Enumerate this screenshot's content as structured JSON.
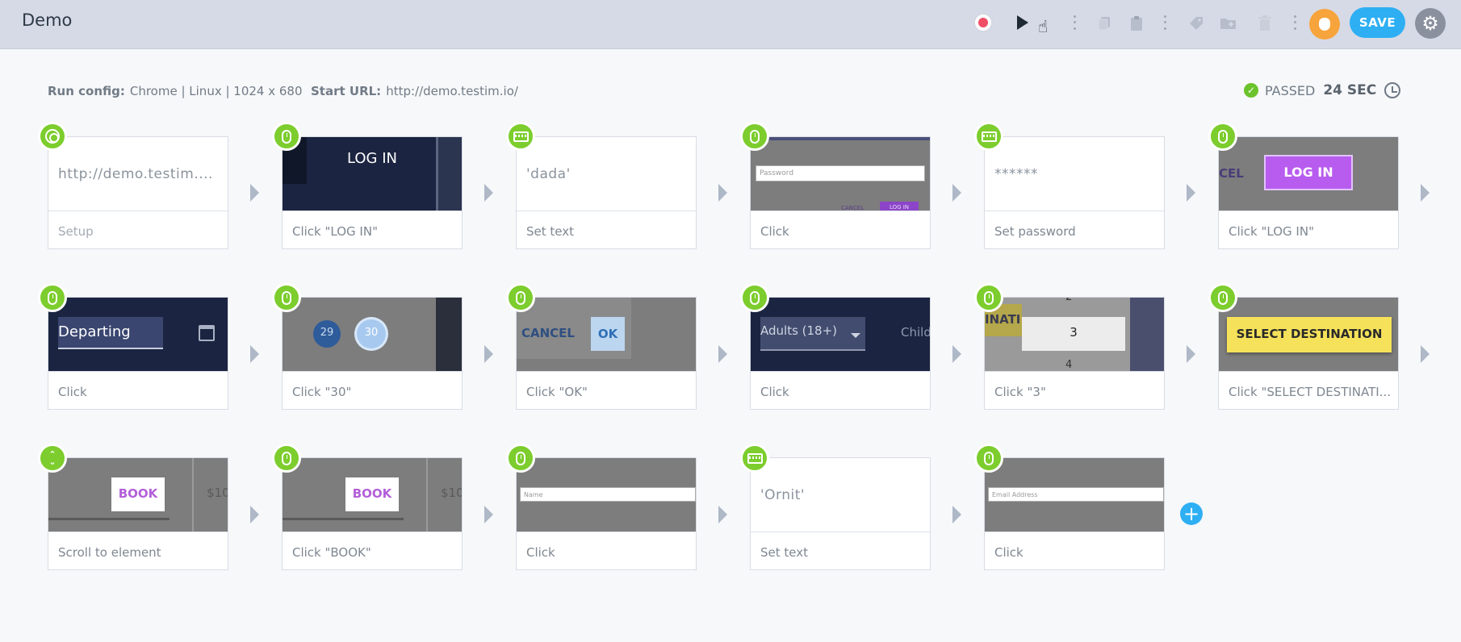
{
  "app": {
    "title": "Demo"
  },
  "toolbar": {
    "save_label": "SAVE"
  },
  "run_config": {
    "label": "Run config:",
    "value": "Chrome | Linux | 1024 x 680"
  },
  "start_url": {
    "label": "Start URL:",
    "value": "http://demo.testim.io/"
  },
  "result": {
    "status": "PASSED",
    "duration": "24 SEC"
  },
  "steps": [
    {
      "label": "Setup",
      "preview_text": "http://demo.testim....",
      "badge": "chrome-icon"
    },
    {
      "label": "Click \"LOG IN\"",
      "preview_text": "LOG IN",
      "badge": "mouse-icon"
    },
    {
      "label": "Set text",
      "preview_text": "'dada'",
      "badge": "keyboard-icon"
    },
    {
      "label": "Click",
      "preview_text": "Password",
      "preview_extra": [
        "CANCEL",
        "LOG IN"
      ],
      "badge": "mouse-icon"
    },
    {
      "label": "Set password",
      "preview_text": "******",
      "badge": "keyboard-icon"
    },
    {
      "label": "Click \"LOG IN\"",
      "preview_text": "LOG IN",
      "preview_extra": [
        "CEL"
      ],
      "badge": "mouse-icon"
    },
    {
      "label": "Click",
      "preview_text": "Departing",
      "badge": "mouse-icon"
    },
    {
      "label": "Click \"30\"",
      "preview_text": "30",
      "preview_extra": [
        "29"
      ],
      "badge": "mouse-icon"
    },
    {
      "label": "Click \"OK\"",
      "preview_text": "OK",
      "preview_extra": [
        "CANCEL"
      ],
      "badge": "mouse-icon"
    },
    {
      "label": "Click",
      "preview_text": "Adults (18+)",
      "preview_extra": [
        "Child"
      ],
      "badge": "mouse-icon"
    },
    {
      "label": "Click \"3\"",
      "preview_text": "3",
      "preview_extra": [
        "2",
        "4",
        "INATI"
      ],
      "badge": "mouse-icon"
    },
    {
      "label": "Click \"SELECT DESTINATI...",
      "preview_text": "SELECT DESTINATION",
      "badge": "mouse-icon"
    },
    {
      "label": "Scroll to element",
      "preview_text": "BOOK",
      "preview_extra": [
        "$10"
      ],
      "badge": "scroll-icon"
    },
    {
      "label": "Click \"BOOK\"",
      "preview_text": "BOOK",
      "preview_extra": [
        "$10"
      ],
      "badge": "mouse-icon"
    },
    {
      "label": "Click",
      "preview_text": "Name",
      "badge": "mouse-icon"
    },
    {
      "label": "Set text",
      "preview_text": "'Ornit'",
      "badge": "keyboard-icon"
    },
    {
      "label": "Click",
      "preview_text": "Email Address",
      "badge": "mouse-icon"
    }
  ],
  "colors": {
    "accent": "#2eaff3",
    "badge": "#7ccd2d",
    "record": "#f04e66",
    "bug": "#f7a43c"
  }
}
